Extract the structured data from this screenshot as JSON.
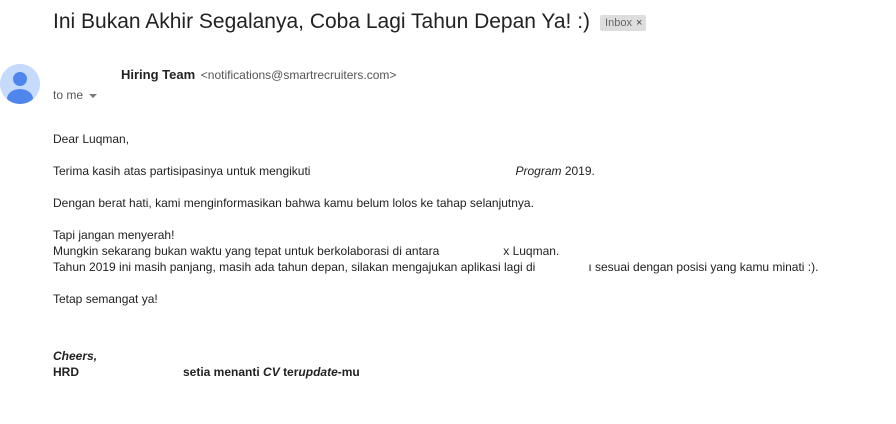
{
  "email": {
    "subject": "Ini Bukan Akhir Segalanya, Coba Lagi Tahun Depan Ya! :)",
    "label": "Inbox",
    "label_close": "×",
    "sender_name": "Hiring Team",
    "sender_email": "<notifications@smartrecruiters.com>",
    "recipient": "to me"
  },
  "body": {
    "greeting": "Dear Luqman,",
    "line1_a": "Terima kasih atas partisipasinya untuk mengikuti",
    "line1_program": "Program",
    "line1_b": "2019.",
    "line2": "Dengan berat hati, kami menginformasikan bahwa kamu belum lolos ke tahap selanjutnya.",
    "line3": "Tapi jangan menyerah!",
    "line4_a": "Mungkin sekarang bukan waktu yang tepat untuk berkolaborasi di antara",
    "line4_b": "x Luqman.",
    "line5_a": "Tahun 2019 ini masih panjang, masih ada tahun depan, silakan mengajukan aplikasi lagi di",
    "line5_b": "ı sesuai dengan posisi yang kamu minati :).",
    "line6": "Tetap semangat ya!",
    "sig_cheers": "Cheers,",
    "sig_hrd": "HRD",
    "sig_tail_a": "setia menanti",
    "sig_cv": "CV",
    "sig_tail_b": "ter",
    "sig_update": "update",
    "sig_tail_c": "-mu"
  }
}
